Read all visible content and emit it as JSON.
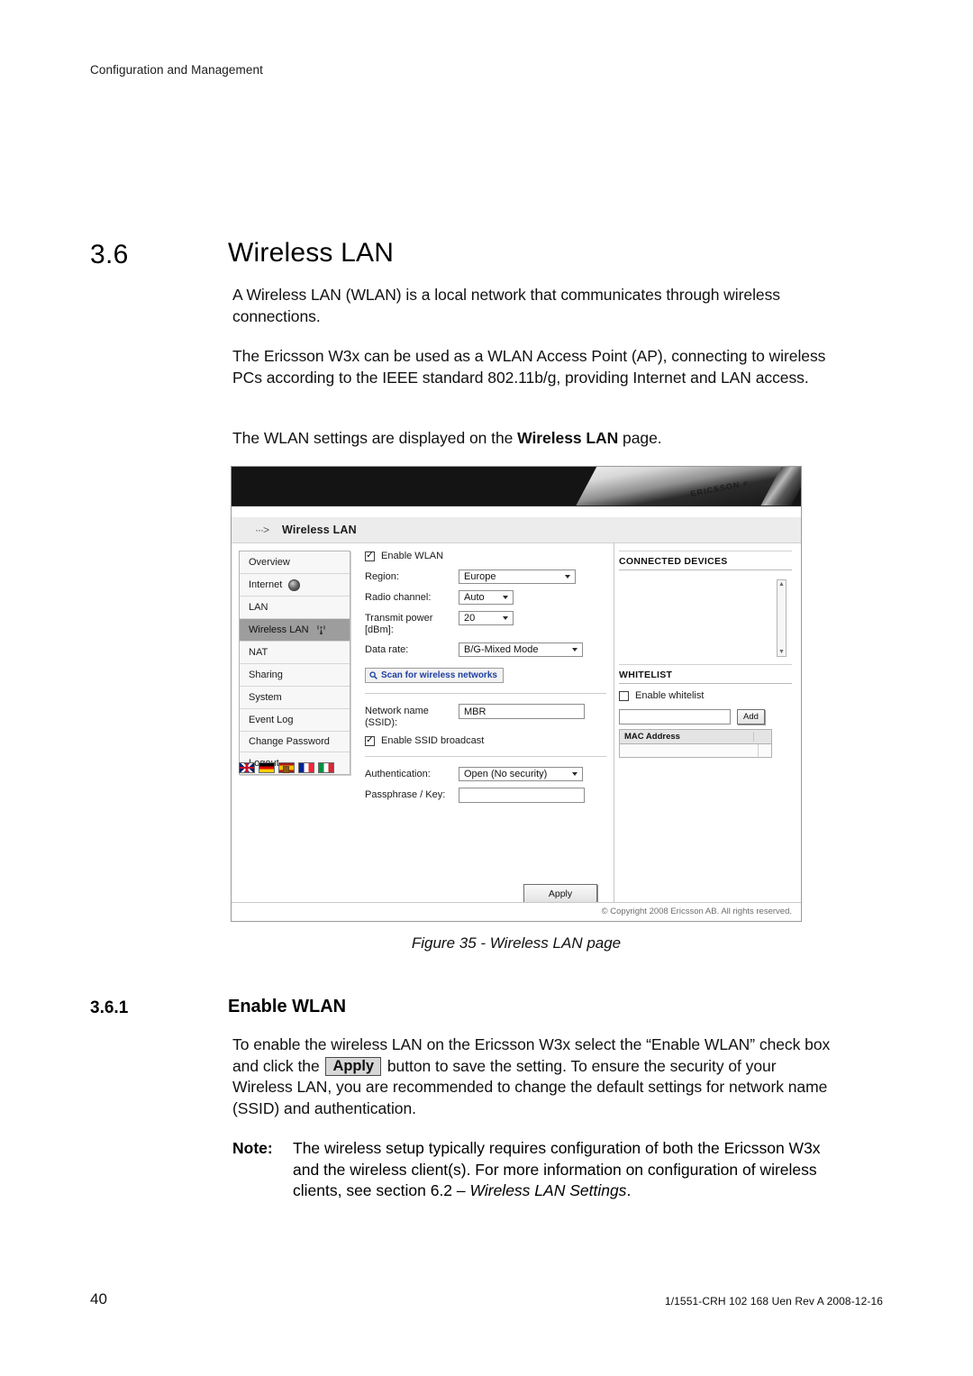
{
  "page": {
    "running_header": "Configuration and Management",
    "page_number": "40",
    "doc_id": "1/1551-CRH 102 168 Uen Rev A  2008-12-16"
  },
  "section": {
    "number": "3.6",
    "title": "Wireless LAN",
    "paragraph1": "A Wireless LAN (WLAN) is a local network that communicates through wireless connections.",
    "paragraph2": "The Ericsson W3x can be used as a WLAN Access Point (AP), connecting to wireless PCs according to the IEEE standard 802.11b/g, providing Internet and LAN access.",
    "paragraph3_prefix": "The WLAN settings are displayed on the ",
    "paragraph3_bold": "Wireless LAN",
    "paragraph3_suffix": " page."
  },
  "figure": {
    "caption": "Figure 35 - Wireless LAN page",
    "banner_logo": "ERICSSON",
    "page_title": "Wireless LAN",
    "title_arrow_icon": "dotted-arrow-icon",
    "copyright": "© Copyright 2008 Ericsson AB. All rights reserved.",
    "nav": {
      "items": [
        {
          "label": "Overview",
          "icon": "",
          "selected": false
        },
        {
          "label": "Internet",
          "icon": "globe-icon",
          "selected": false
        },
        {
          "label": "LAN",
          "icon": "",
          "selected": false
        },
        {
          "label": "Wireless LAN",
          "icon": "wifi-antenna-icon",
          "selected": true
        },
        {
          "label": "NAT",
          "icon": "",
          "selected": false
        },
        {
          "label": "Sharing",
          "icon": "",
          "selected": false
        },
        {
          "label": "System",
          "icon": "",
          "selected": false
        },
        {
          "label": "Event Log",
          "icon": "",
          "selected": false
        },
        {
          "label": "Change Password",
          "icon": "",
          "selected": false
        },
        {
          "label": "Logout",
          "icon": "",
          "selected": false
        }
      ],
      "flags": [
        "flag-uk",
        "flag-germany",
        "flag-spain",
        "flag-france",
        "flag-italy"
      ]
    },
    "form": {
      "enable_wlan_label": "Enable WLAN",
      "enable_wlan_checked": true,
      "region_label": "Region:",
      "region_value": "Europe",
      "radio_channel_label": "Radio channel:",
      "radio_channel_value": "Auto",
      "transmit_power_label": "Transmit power [dBm]:",
      "transmit_power_value": "20",
      "data_rate_label": "Data rate:",
      "data_rate_value": "B/G-Mixed Mode",
      "scan_button_label": "Scan for wireless networks",
      "scan_button_icon": "search-icon",
      "ssid_label": "Network name (SSID):",
      "ssid_value": "MBR",
      "ssid_broadcast_label": "Enable SSID broadcast",
      "ssid_broadcast_checked": true,
      "authentication_label": "Authentication:",
      "authentication_value": "Open (No security)",
      "passphrase_label": "Passphrase / Key:",
      "passphrase_value": "",
      "apply_button_label": "Apply"
    },
    "connected_devices": {
      "title": "CONNECTED DEVICES",
      "items": []
    },
    "whitelist": {
      "title": "WHITELIST",
      "enable_label": "Enable whitelist",
      "enable_checked": false,
      "mac_input_value": "",
      "add_button_label": "Add",
      "table_header": "MAC Address",
      "rows": []
    }
  },
  "subsection": {
    "number": "3.6.1",
    "title": "Enable WLAN",
    "body_part1": "To enable the wireless LAN on the Ericsson W3x select the “Enable WLAN” check box and click the ",
    "body_button": "Apply",
    "body_part2": " button to save the setting. To ensure the security of your Wireless LAN, you are recommended to change the default settings for network name (SSID) and authentication.",
    "note_label": "Note:",
    "note_part1": "The wireless setup typically requires configuration of both the Ericsson W3x and the wireless client(s). For more information on configuration of wireless clients, see section 6.2 – ",
    "note_italic": "Wireless LAN Settings",
    "note_part2": "."
  }
}
